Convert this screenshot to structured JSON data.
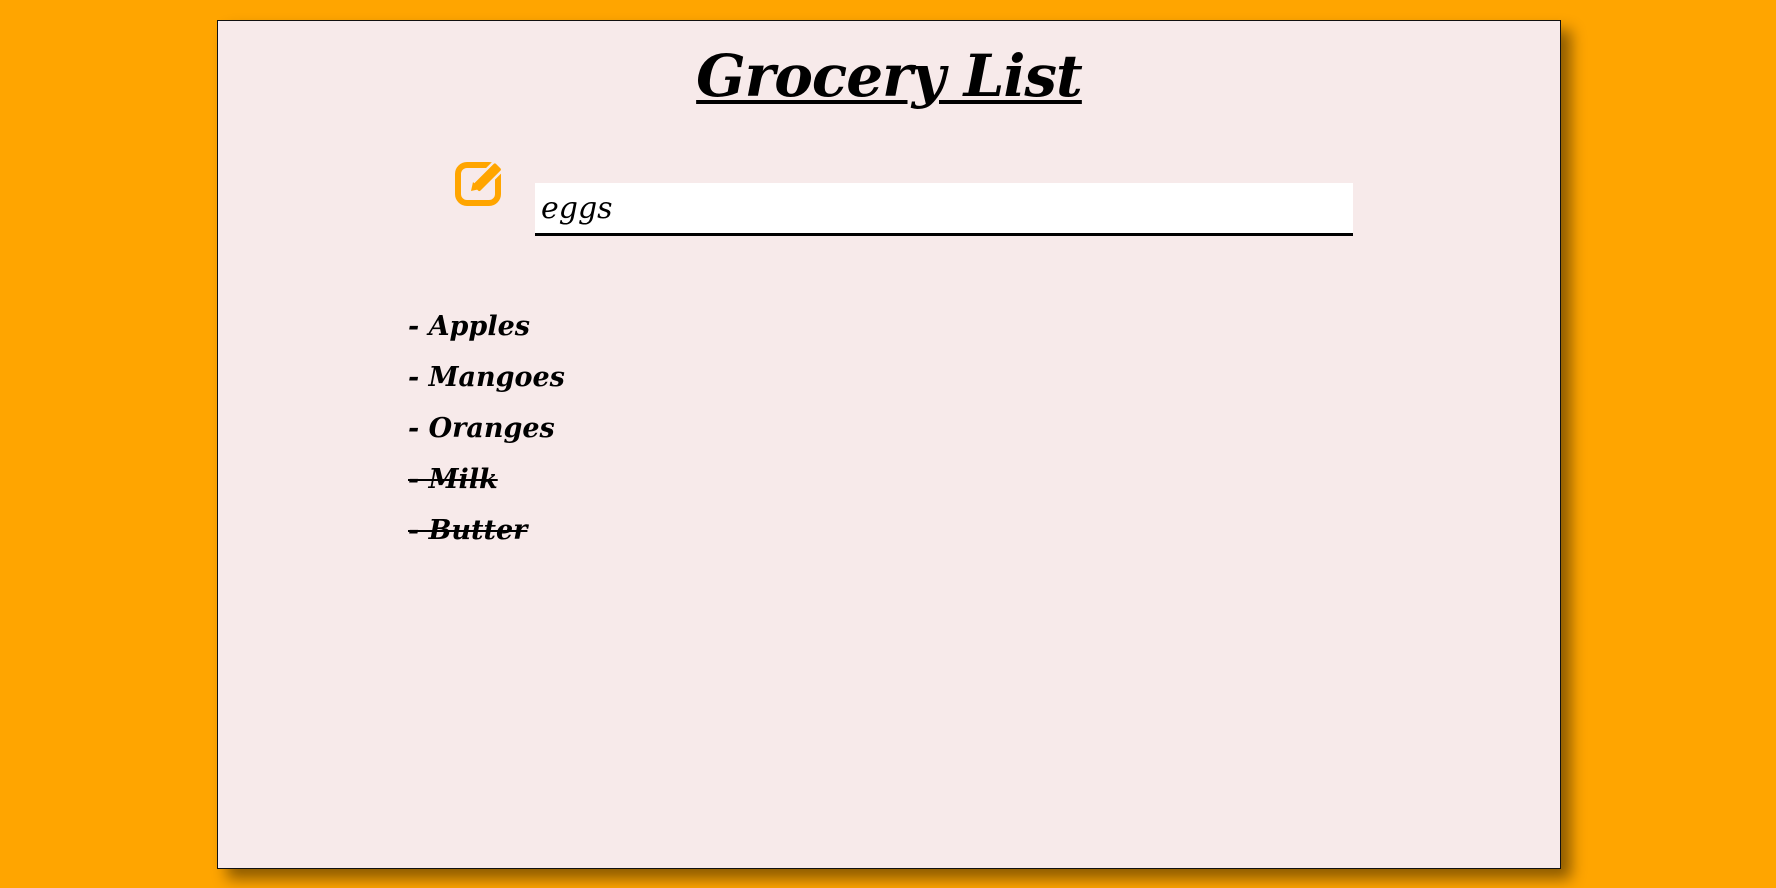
{
  "header": {
    "title": "Grocery List"
  },
  "entry": {
    "icon": "edit-icon",
    "value": "eggs",
    "placeholder": ""
  },
  "items": [
    {
      "label": "- Apples",
      "done": false
    },
    {
      "label": "- Mangoes",
      "done": false
    },
    {
      "label": "- Oranges",
      "done": false
    },
    {
      "label": "- Milk",
      "done": true
    },
    {
      "label": "- Butter",
      "done": true
    }
  ],
  "colors": {
    "background": "#FFA500",
    "card": "#F7EAEA",
    "accent": "#FFA500",
    "text": "#000000"
  }
}
